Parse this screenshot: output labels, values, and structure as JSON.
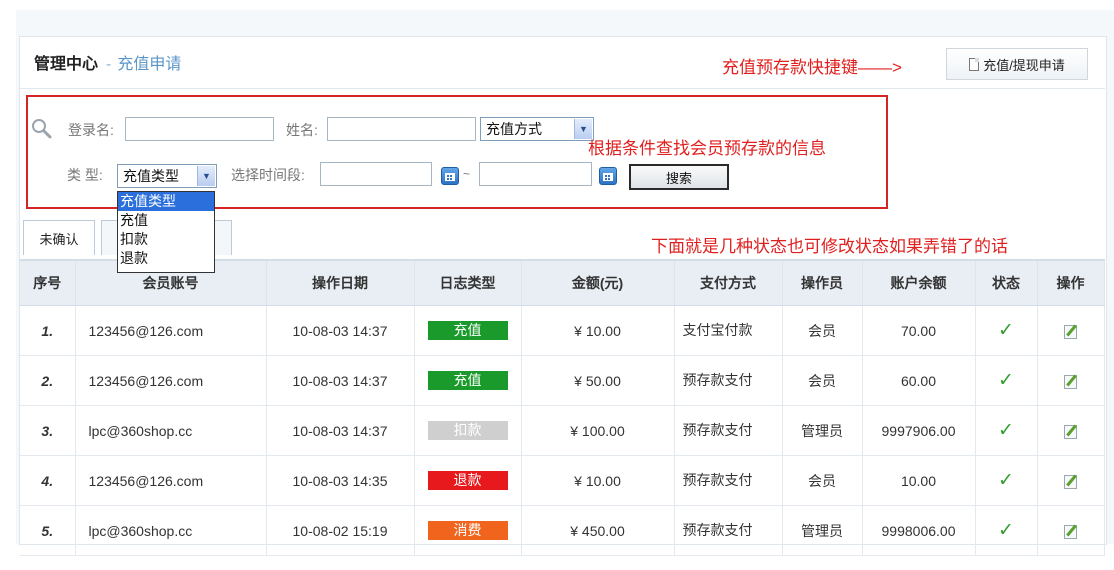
{
  "header": {
    "title": "管理中心",
    "separator": "-",
    "subtitle": "充值申请"
  },
  "annotations": {
    "quick_key": "充值预存款快捷键——>",
    "search_hint": "根据条件查找会员预存款的信息",
    "status_hint": "下面就是几种状态也可修改状态如果弄错了的话"
  },
  "quick_button": {
    "label": "充值/提现申请",
    "icon": "document-icon"
  },
  "search": {
    "login_label": "登录名:",
    "login_value": "",
    "name_label": "姓名:",
    "name_value": "",
    "method_select": "充值方式",
    "type_label": "类 型:",
    "type_select": "充值类型",
    "period_label": "选择时间段:",
    "period_separator": "~",
    "start_date": "",
    "end_date": "",
    "search_button": "搜索",
    "search_icon": "magnifier-icon",
    "calendar_icon": "calendar-icon"
  },
  "type_dropdown": {
    "options": [
      "充值类型",
      "充值",
      "扣款",
      "退款"
    ],
    "selected": 0
  },
  "tabs": [
    {
      "label": "未确认"
    },
    {
      "label": ""
    },
    {
      "label": ""
    }
  ],
  "table": {
    "headers": [
      "序号",
      "会员账号",
      "操作日期",
      "日志类型",
      "金额(元)",
      "支付方式",
      "操作员",
      "账户余额",
      "状态",
      "操作"
    ],
    "rows": [
      {
        "index": "1.",
        "account": "123456@126.com",
        "date": "10-08-03 14:37",
        "type": "充值",
        "type_color": "#1a9a2a",
        "amount": "¥ 10.00",
        "payment": "支付宝付款",
        "operator": "会员",
        "balance": "70.00",
        "status": "✓",
        "action_icon": "edit-icon"
      },
      {
        "index": "2.",
        "account": "123456@126.com",
        "date": "10-08-03 14:37",
        "type": "充值",
        "type_color": "#1a9a2a",
        "amount": "¥ 50.00",
        "payment": "预存款支付",
        "operator": "会员",
        "balance": "60.00",
        "status": "✓",
        "action_icon": "edit-icon"
      },
      {
        "index": "3.",
        "account": "lpc@360shop.cc",
        "date": "10-08-03 14:37",
        "type": "扣款",
        "type_color": "#cfcfcf",
        "amount": "¥ 100.00",
        "payment": "预存款支付",
        "operator": "管理员",
        "balance": "9997906.00",
        "status": "✓",
        "action_icon": "edit-icon"
      },
      {
        "index": "4.",
        "account": "123456@126.com",
        "date": "10-08-03 14:35",
        "type": "退款",
        "type_color": "#e8191c",
        "amount": "¥ 10.00",
        "payment": "预存款支付",
        "operator": "会员",
        "balance": "10.00",
        "status": "✓",
        "action_icon": "edit-icon"
      },
      {
        "index": "5.",
        "account": "lpc@360shop.cc",
        "date": "10-08-02 15:19",
        "type": "消费",
        "type_color": "#f0641e",
        "amount": "¥ 450.00",
        "payment": "预存款支付",
        "operator": "管理员",
        "balance": "9998006.00",
        "status": "✓",
        "action_icon": "edit-icon"
      }
    ]
  }
}
